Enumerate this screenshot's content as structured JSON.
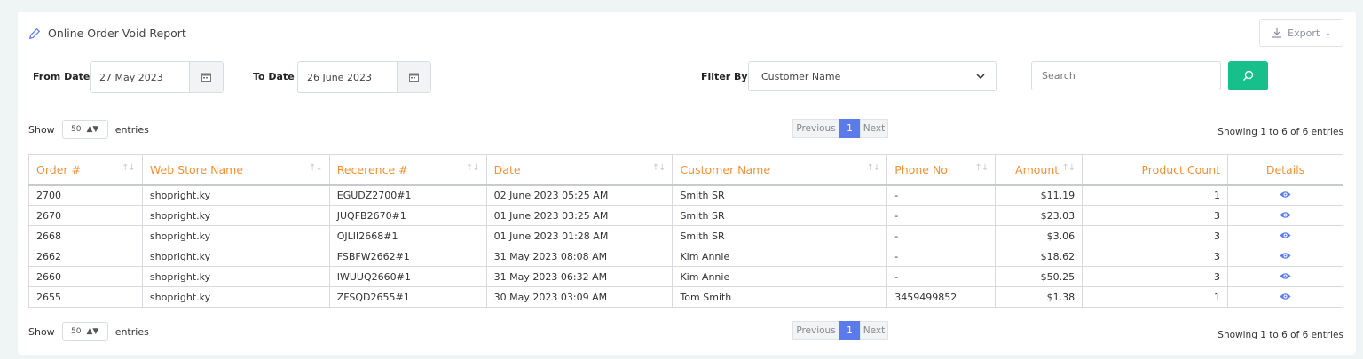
{
  "header": {
    "title": "Online Order Void Report",
    "export_label": "Export"
  },
  "filters": {
    "from_label": "From Date",
    "from_value": "27 May 2023",
    "to_label": "To Date",
    "to_value": "26 June 2023",
    "filter_label": "Filter By",
    "filter_value": "Customer Name",
    "search_placeholder": "Search"
  },
  "paging": {
    "show_label": "Show",
    "entries_value": "50",
    "entries_label": "entries",
    "prev_label": "Previous",
    "page": "1",
    "next_label": "Next",
    "info": "Showing 1 to 6 of 6 entries"
  },
  "table": {
    "columns": [
      "Order #",
      "Web Store Name",
      "Recerence #",
      "Date",
      "Customer Name",
      "Phone No",
      "Amount",
      "Product Count",
      "Details"
    ],
    "rows": [
      [
        "2700",
        "shopright.ky",
        "EGUDZ2700#1",
        "02 June 2023 05:25 AM",
        "Smith SR",
        "-",
        "$11.19",
        "1"
      ],
      [
        "2670",
        "shopright.ky",
        "JUQFB2670#1",
        "01 June 2023 03:25 AM",
        "Smith SR",
        "-",
        "$23.03",
        "3"
      ],
      [
        "2668",
        "shopright.ky",
        "OJLII2668#1",
        "01 June 2023 01:28 AM",
        "Smith SR",
        "-",
        "$3.06",
        "3"
      ],
      [
        "2662",
        "shopright.ky",
        "FSBFW2662#1",
        "31 May 2023 08:08 AM",
        "Kim Annie",
        "-",
        "$18.62",
        "3"
      ],
      [
        "2660",
        "shopright.ky",
        "IWUUQ2660#1",
        "31 May 2023 06:32 AM",
        "Kim Annie",
        "-",
        "$50.25",
        "3"
      ],
      [
        "2655",
        "shopright.ky",
        "ZFSQD2655#1",
        "30 May 2023 03:09 AM",
        "Tom Smith",
        "3459499852",
        "$1.38",
        "1"
      ]
    ]
  },
  "colors": {
    "accent": "#f0913a",
    "primary": "#5b7bea",
    "success": "#17c08a"
  },
  "icons": {
    "title": "pencil-icon",
    "export": "download-icon",
    "calendar": "calendar-icon",
    "search": "search-icon",
    "details": "eye-icon"
  }
}
